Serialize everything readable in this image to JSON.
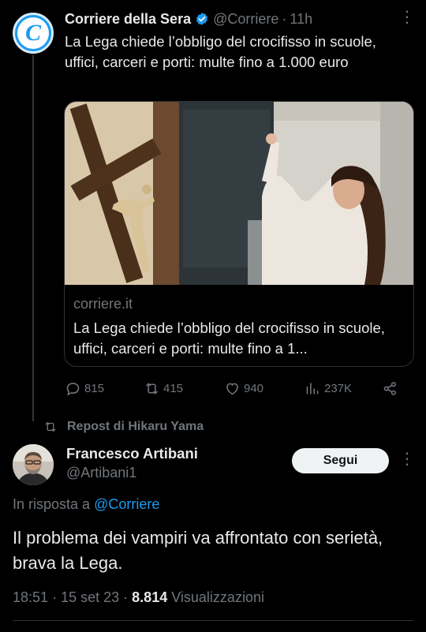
{
  "parent_tweet": {
    "avatar_letter": "C",
    "author_name": "Corriere della Sera",
    "handle": "@Corriere",
    "separator": "·",
    "time": "11h",
    "text": "La Lega chiede l’obbligo del crocifisso in scuole, uffici, carceri e porti: multe fino a 1.000 euro",
    "card": {
      "domain": "corriere.it",
      "title": "La Lega chiede l’obbligo del crocifisso in scuole, uffici, carceri e porti: multe fino a 1..."
    },
    "actions": {
      "replies": "815",
      "reposts": "415",
      "likes": "940",
      "views": "237K"
    }
  },
  "repost_label": "Repost di Hikaru Yama",
  "main_tweet": {
    "author_name": "Francesco Artibani",
    "handle": "@Artibani1",
    "follow_label": "Segui",
    "reply_prefix": "In risposta a",
    "reply_mention": "@Corriere",
    "text": "Il problema dei vampiri va affrontato con serietà, brava la Lega.",
    "time": "18:51",
    "date": "15 set 23",
    "separator": "·",
    "views_count": "8.814",
    "views_label": "Visualizzazioni"
  },
  "colors": {
    "background": "#000000",
    "text_primary": "#e7e9ea",
    "text_secondary": "#71767b",
    "accent": "#1d9bf0",
    "follow_button_bg": "#eff3f4"
  },
  "icons": [
    "verified-badge-icon",
    "more-icon",
    "reply-icon",
    "repost-icon",
    "like-icon",
    "views-icon",
    "share-icon"
  ]
}
